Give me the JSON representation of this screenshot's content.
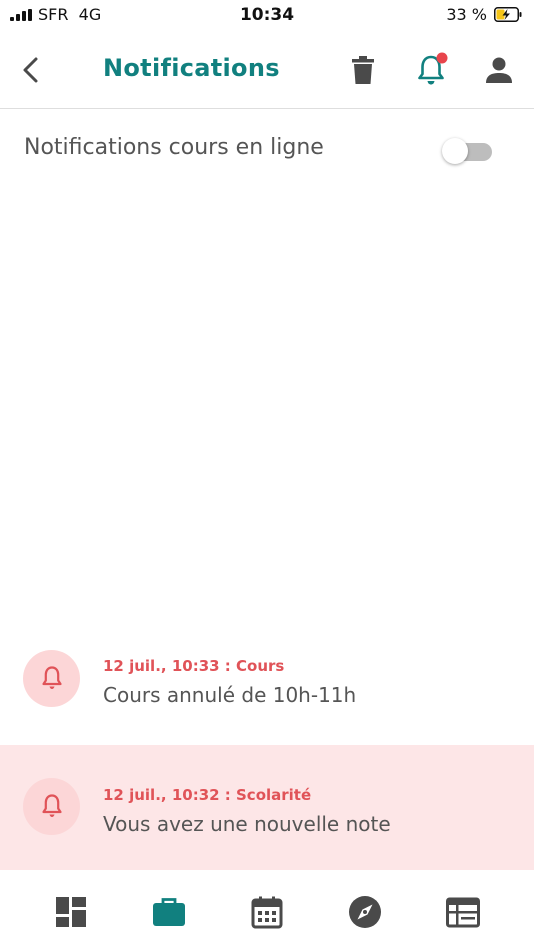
{
  "status_bar": {
    "carrier": "SFR",
    "network": "4G",
    "time": "10:34",
    "battery": "33 %"
  },
  "header": {
    "title": "Notifications",
    "icons": [
      "back-icon",
      "trash-icon",
      "bell-icon",
      "person-icon"
    ],
    "bell_badge_color": "#e8454c"
  },
  "settings": {
    "online_courses_label": "Notifications cours en ligne",
    "online_courses_enabled": false
  },
  "notifications": [
    {
      "meta": "12 juil., 10:33 : Cours",
      "text": "Cours annulé de 10h-11h",
      "unread": false
    },
    {
      "meta": "12 juil., 10:32 : Scolarité",
      "text": "Vous avez une nouvelle note",
      "unread": true
    }
  ],
  "bottom_nav": {
    "items": [
      "dashboard-icon",
      "briefcase-icon",
      "calendar-icon",
      "compass-icon",
      "timetable-icon"
    ],
    "active": "briefcase-icon"
  },
  "colors": {
    "accent": "#11807f",
    "alert": "#e05358",
    "unread_bg": "#fde6e7",
    "icon_gray": "#4a4a4a"
  }
}
